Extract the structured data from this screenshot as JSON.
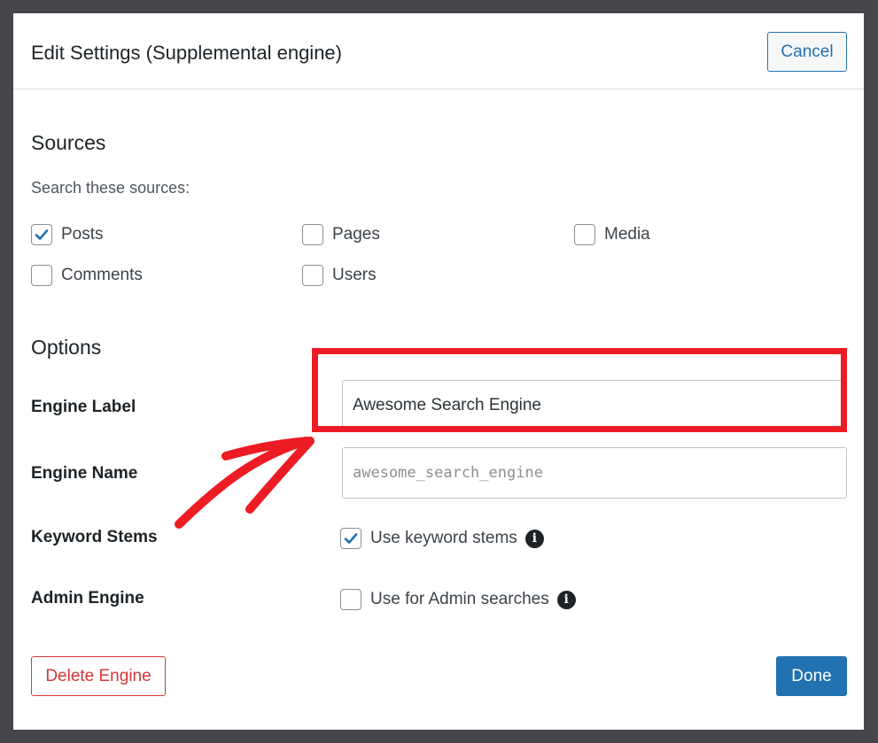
{
  "modal": {
    "title": "Edit Settings (Supplemental engine)",
    "cancel_label": "Cancel"
  },
  "sources": {
    "heading": "Sources",
    "subheading": "Search these sources:",
    "items": [
      {
        "label": "Posts",
        "checked": true
      },
      {
        "label": "Pages",
        "checked": false
      },
      {
        "label": "Media",
        "checked": false
      },
      {
        "label": "Comments",
        "checked": false
      },
      {
        "label": "Users",
        "checked": false
      }
    ]
  },
  "options": {
    "heading": "Options",
    "engine_label": {
      "label": "Engine Label",
      "value": "Awesome Search Engine"
    },
    "engine_name": {
      "label": "Engine Name",
      "value": "awesome_search_engine"
    },
    "keyword_stems": {
      "label": "Keyword Stems",
      "checkbox_label": "Use keyword stems",
      "checked": true
    },
    "admin_engine": {
      "label": "Admin Engine",
      "checkbox_label": "Use for Admin searches",
      "checked": false
    }
  },
  "footer": {
    "delete_label": "Delete Engine",
    "done_label": "Done"
  },
  "colors": {
    "accent": "#2271b1",
    "danger": "#d63638",
    "annotation": "#ed1c24"
  },
  "icons": {
    "checkmark": "checkmark-icon",
    "info": "info-icon",
    "annotation_arrow": "arrow-annotation"
  }
}
